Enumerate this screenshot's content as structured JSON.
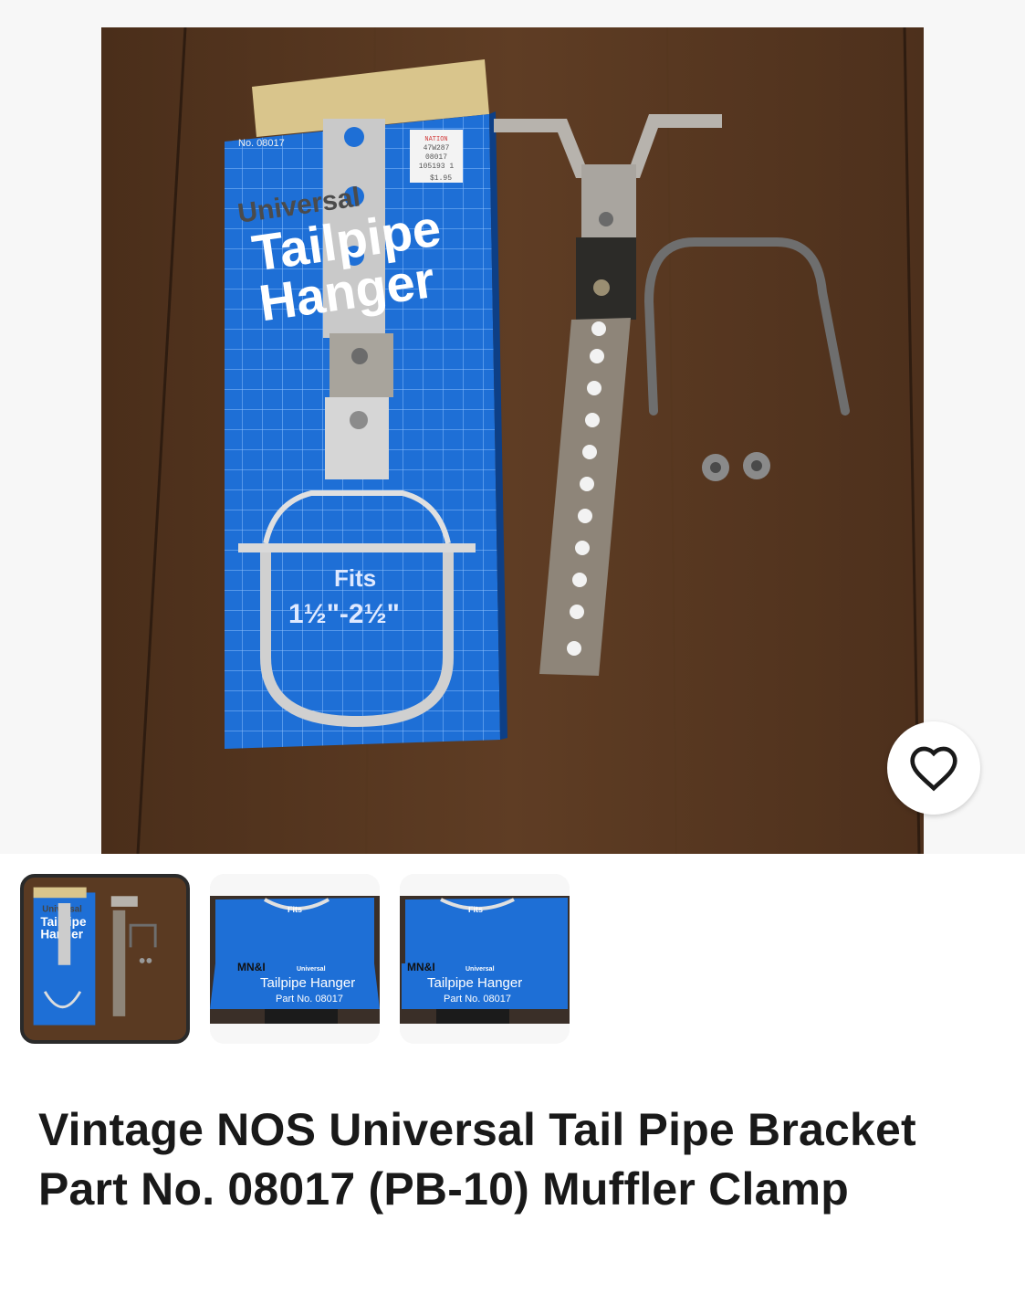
{
  "listing": {
    "title": "Vintage NOS Universal Tail Pipe Bracket Part No. 08017 (PB-10) Muffler Clamp"
  },
  "hero_image": {
    "box_text": {
      "part_no": "No. 08017",
      "brand_line": "Universal",
      "name_line1": "Tailpipe",
      "name_line2": "Hanger",
      "fits": "Fits",
      "size": "1½\"-2½\"",
      "price_tag": [
        "NATION",
        "47W287",
        "08017",
        "105193 1",
        "$1.95"
      ]
    }
  },
  "thumbnails": [
    {
      "id": "thumb-1",
      "selected": true,
      "text": [
        "Universal",
        "Tailpipe",
        "Hanger"
      ]
    },
    {
      "id": "thumb-2",
      "selected": false,
      "text": [
        "Fits",
        "MN&I",
        "Universal",
        "Tailpipe Hanger",
        "Part No. 08017"
      ]
    },
    {
      "id": "thumb-3",
      "selected": false,
      "text": [
        "Fits",
        "MN&I",
        "Universal",
        "Tailpipe Hanger",
        "Part No. 08017"
      ]
    }
  ],
  "actions": {
    "favorite_icon": "heart-outline-icon"
  },
  "colors": {
    "box_blue": "#1e6fd6",
    "wood": "#5a3a22",
    "text_primary": "#191919"
  }
}
